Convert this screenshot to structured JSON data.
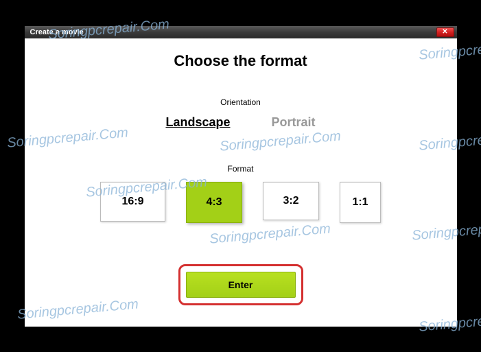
{
  "window": {
    "title": "Create a movie"
  },
  "heading": "Choose the format",
  "sections": {
    "orientation_label": "Orientation",
    "format_label": "Format"
  },
  "orientation": {
    "options": [
      {
        "label": "Landscape",
        "selected": true
      },
      {
        "label": "Portrait",
        "selected": false
      }
    ]
  },
  "format": {
    "options": [
      {
        "label": "16:9",
        "selected": false,
        "class": "w169"
      },
      {
        "label": "4:3",
        "selected": true,
        "class": "w43"
      },
      {
        "label": "3:2",
        "selected": false,
        "class": "w32"
      },
      {
        "label": "1:1",
        "selected": false,
        "class": "w11"
      }
    ]
  },
  "actions": {
    "enter_label": "Enter"
  },
  "watermark_text": "Soringpcrepair.Com"
}
